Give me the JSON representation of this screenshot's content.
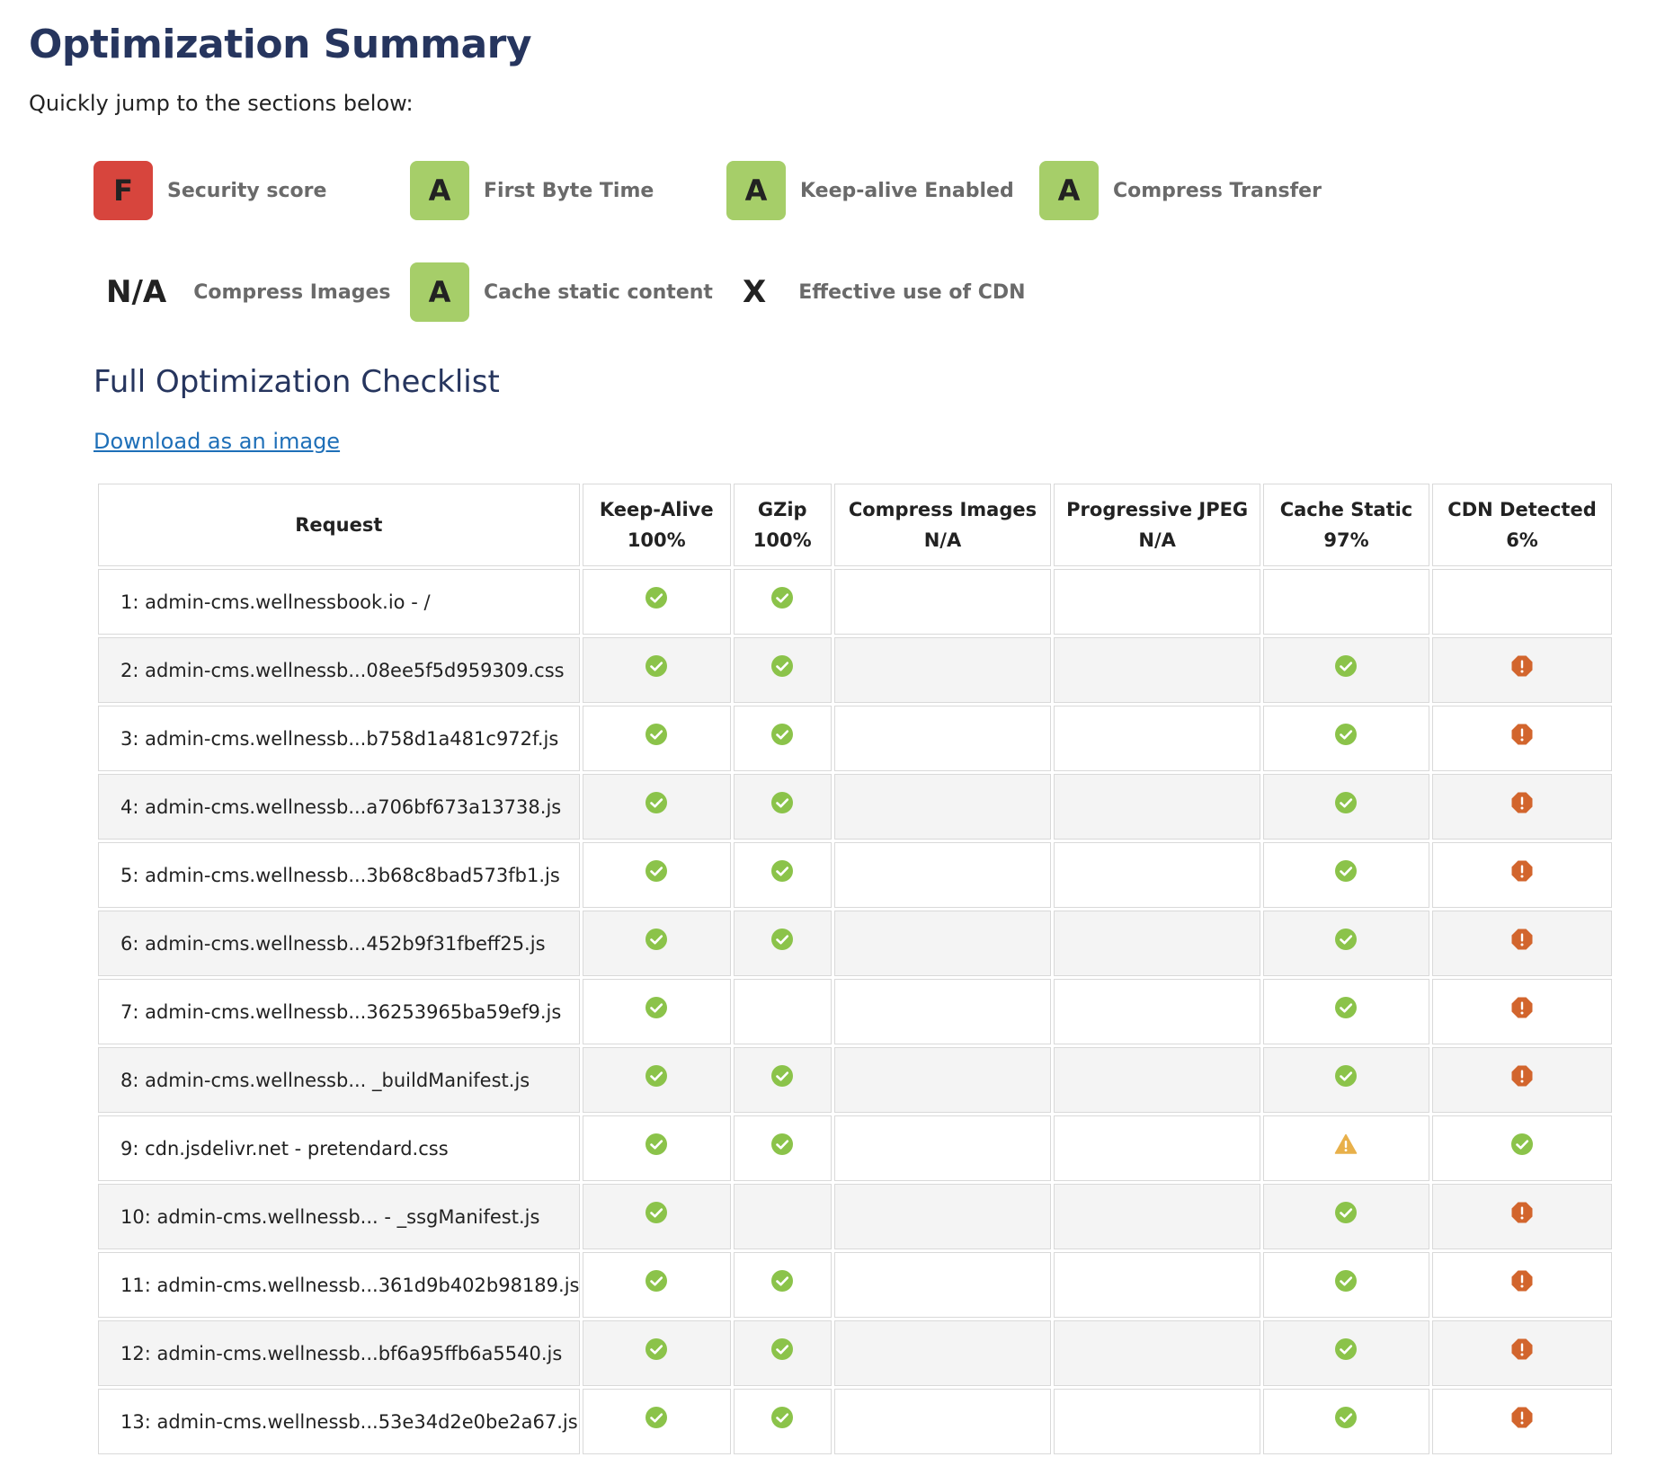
{
  "page": {
    "title": "Optimization Summary",
    "intro": "Quickly jump to the sections below:"
  },
  "grades": [
    {
      "grade": "F",
      "label": "Security score",
      "style": "fail",
      "color": "#d7453d"
    },
    {
      "grade": "A",
      "label": "First Byte Time",
      "style": "pass",
      "color": "#a6ce69"
    },
    {
      "grade": "A",
      "label": "Keep-alive Enabled",
      "style": "pass",
      "color": "#a6ce69"
    },
    {
      "grade": "A",
      "label": "Compress Transfer",
      "style": "pass",
      "color": "#a6ce69"
    },
    {
      "grade": "N/A",
      "label": "Compress Images",
      "style": "plain"
    },
    {
      "grade": "A",
      "label": "Cache static content",
      "style": "pass",
      "color": "#a6ce69"
    },
    {
      "grade": "X",
      "label": "Effective use of CDN",
      "style": "plain"
    }
  ],
  "checklist": {
    "heading": "Full Optimization Checklist",
    "download_label": "Download as an image",
    "columns": [
      {
        "name": "Request",
        "value": ""
      },
      {
        "name": "Keep-Alive",
        "value": "100%"
      },
      {
        "name": "GZip",
        "value": "100%"
      },
      {
        "name": "Compress Images",
        "value": "N/A"
      },
      {
        "name": "Progressive JPEG",
        "value": "N/A"
      },
      {
        "name": "Cache Static",
        "value": "97%"
      },
      {
        "name": "CDN Detected",
        "value": "6%"
      }
    ],
    "status_colors": {
      "pass": "#8bc34a",
      "warn": "#e8b04a",
      "fail": "#d2652d"
    },
    "rows": [
      {
        "request": "1: admin-cms.wellnessbook.io - /",
        "keepalive": "pass",
        "gzip": "pass",
        "compress": "",
        "progressive": "",
        "cache": "",
        "cdn": ""
      },
      {
        "request": "2: admin-cms.wellnessb...08ee5f5d959309.css",
        "keepalive": "pass",
        "gzip": "pass",
        "compress": "",
        "progressive": "",
        "cache": "pass",
        "cdn": "fail"
      },
      {
        "request": "3: admin-cms.wellnessb...b758d1a481c972f.js",
        "keepalive": "pass",
        "gzip": "pass",
        "compress": "",
        "progressive": "",
        "cache": "pass",
        "cdn": "fail"
      },
      {
        "request": "4: admin-cms.wellnessb...a706bf673a13738.js",
        "keepalive": "pass",
        "gzip": "pass",
        "compress": "",
        "progressive": "",
        "cache": "pass",
        "cdn": "fail"
      },
      {
        "request": "5: admin-cms.wellnessb...3b68c8bad573fb1.js",
        "keepalive": "pass",
        "gzip": "pass",
        "compress": "",
        "progressive": "",
        "cache": "pass",
        "cdn": "fail"
      },
      {
        "request": "6: admin-cms.wellnessb...452b9f31fbeff25.js",
        "keepalive": "pass",
        "gzip": "pass",
        "compress": "",
        "progressive": "",
        "cache": "pass",
        "cdn": "fail"
      },
      {
        "request": "7: admin-cms.wellnessb...36253965ba59ef9.js",
        "keepalive": "pass",
        "gzip": "",
        "compress": "",
        "progressive": "",
        "cache": "pass",
        "cdn": "fail"
      },
      {
        "request": "8: admin-cms.wellnessb... _buildManifest.js",
        "keepalive": "pass",
        "gzip": "pass",
        "compress": "",
        "progressive": "",
        "cache": "pass",
        "cdn": "fail"
      },
      {
        "request": "9: cdn.jsdelivr.net - pretendard.css",
        "keepalive": "pass",
        "gzip": "pass",
        "compress": "",
        "progressive": "",
        "cache": "warn",
        "cdn": "pass"
      },
      {
        "request": "10: admin-cms.wellnessb... - _ssgManifest.js",
        "keepalive": "pass",
        "gzip": "",
        "compress": "",
        "progressive": "",
        "cache": "pass",
        "cdn": "fail"
      },
      {
        "request": "11: admin-cms.wellnessb...361d9b402b98189.js",
        "keepalive": "pass",
        "gzip": "pass",
        "compress": "",
        "progressive": "",
        "cache": "pass",
        "cdn": "fail"
      },
      {
        "request": "12: admin-cms.wellnessb...bf6a95ffb6a5540.js",
        "keepalive": "pass",
        "gzip": "pass",
        "compress": "",
        "progressive": "",
        "cache": "pass",
        "cdn": "fail"
      },
      {
        "request": "13: admin-cms.wellnessb...53e34d2e0be2a67.js",
        "keepalive": "pass",
        "gzip": "pass",
        "compress": "",
        "progressive": "",
        "cache": "pass",
        "cdn": "fail"
      }
    ]
  }
}
